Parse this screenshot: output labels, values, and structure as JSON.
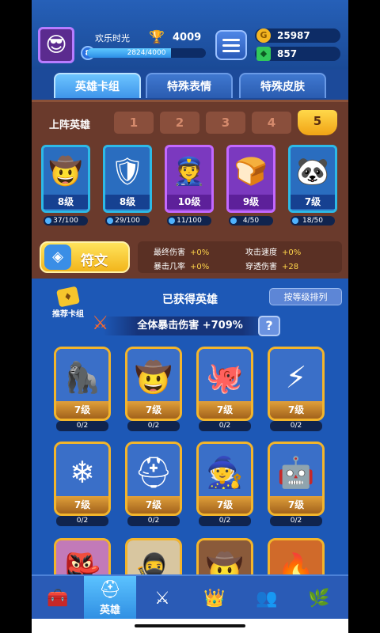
{
  "player": {
    "name": "欢乐时光",
    "level": "8",
    "trophies": "4009",
    "xp_text": "2824/4000",
    "xp_fraction": 0.706
  },
  "currency": {
    "gold": "25987",
    "gems": "857"
  },
  "tabs": [
    {
      "label": "英雄卡组",
      "active": true
    },
    {
      "label": "特殊表情",
      "active": false
    },
    {
      "label": "特殊皮肤",
      "active": false
    }
  ],
  "lineup": {
    "label": "上阵英雄",
    "slots": [
      "1",
      "2",
      "3",
      "4",
      "5"
    ],
    "active_slot": "5",
    "heroes": [
      {
        "level": "8级",
        "progress": "37/100",
        "frame": "blue",
        "icon": "hat-hero-icon"
      },
      {
        "level": "8级",
        "progress": "29/100",
        "frame": "blue",
        "icon": "knight-hero-icon"
      },
      {
        "level": "10级",
        "progress": "11/100",
        "frame": "purple",
        "icon": "police-hero-icon"
      },
      {
        "level": "9级",
        "progress": "4/50",
        "frame": "purple",
        "icon": "toast-hero-icon"
      },
      {
        "level": "7级",
        "progress": "18/50",
        "frame": "blue",
        "icon": "panda-hero-icon"
      }
    ]
  },
  "rune": {
    "label": "符文"
  },
  "stats": [
    {
      "label": "最终伤害",
      "value": "+0%"
    },
    {
      "label": "攻击速度",
      "value": "+0%"
    },
    {
      "label": "暴击几率",
      "value": "+0%"
    },
    {
      "label": "穿透伤害",
      "value": "+28"
    }
  ],
  "owned": {
    "recommend_label": "推荐卡组",
    "title": "已获得英雄",
    "sort_label": "按等级排列",
    "crit_label": "全体暴击伤害",
    "crit_value": "+709%",
    "help": "?"
  },
  "grid": [
    {
      "level": "7级",
      "progress": "0/2",
      "icon": "yeti-hero-icon"
    },
    {
      "level": "7级",
      "progress": "0/2",
      "icon": "cowboy-hero-icon"
    },
    {
      "level": "7级",
      "progress": "0/2",
      "icon": "octopus-pirate-hero-icon"
    },
    {
      "level": "7级",
      "progress": "0/2",
      "icon": "zeus-hero-icon"
    },
    {
      "level": "7级",
      "progress": "0/2",
      "icon": "ice-yeti-hero-icon"
    },
    {
      "level": "7级",
      "progress": "0/2",
      "icon": "spartan-hero-icon"
    },
    {
      "level": "7级",
      "progress": "0/2",
      "icon": "witch-hero-icon"
    },
    {
      "level": "7级",
      "progress": "0/2",
      "icon": "robot-hero-icon"
    }
  ],
  "nav": [
    {
      "icon": "chest-icon",
      "label": ""
    },
    {
      "icon": "helmet-icon",
      "label": "英雄",
      "active": true
    },
    {
      "icon": "swords-icon",
      "label": ""
    },
    {
      "icon": "crown-shield-icon",
      "label": ""
    },
    {
      "icon": "guild-icon",
      "label": ""
    },
    {
      "icon": "island-icon",
      "label": ""
    }
  ]
}
